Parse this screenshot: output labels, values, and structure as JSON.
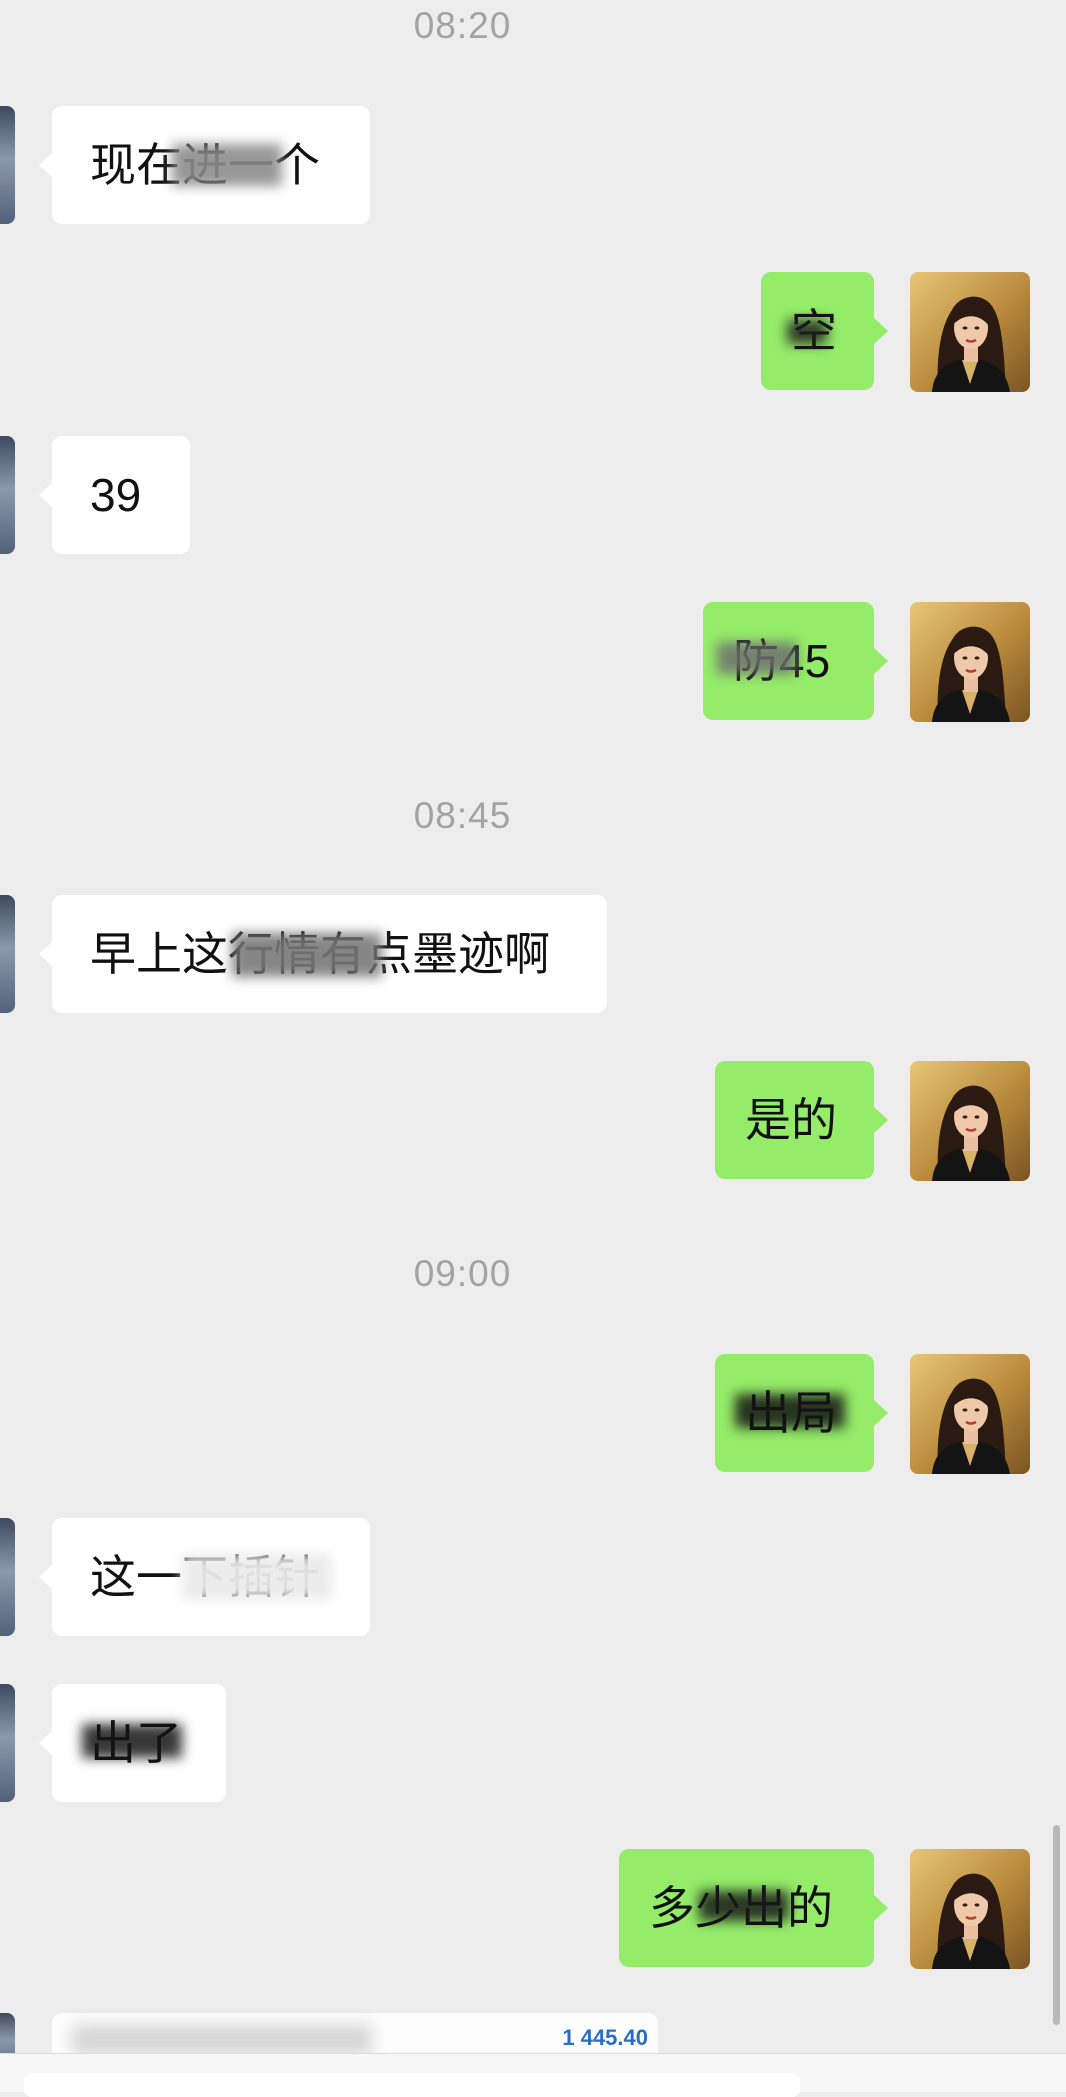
{
  "timestamps": [
    "08:20",
    "08:45",
    "09:00"
  ],
  "messages": [
    {
      "side": "in",
      "text": "现在进一个"
    },
    {
      "side": "out",
      "text": "空"
    },
    {
      "side": "in",
      "text": "39"
    },
    {
      "side": "out",
      "text": "防45"
    },
    {
      "side": "in",
      "text": "早上这行情有点墨迹啊"
    },
    {
      "side": "out",
      "text": "是的"
    },
    {
      "side": "out",
      "text": "出局"
    },
    {
      "side": "in",
      "text": "这一下插针"
    },
    {
      "side": "in",
      "text": "出了"
    },
    {
      "side": "out",
      "text": "多少出的"
    }
  ],
  "preview": {
    "amount": "1 445.40"
  },
  "colors": {
    "background": "#ededed",
    "outgoing_bubble": "#95ec69",
    "incoming_bubble": "#ffffff",
    "timestamp": "#a3a3a3",
    "amount": "#2a6cc6"
  },
  "icons": {
    "incoming_avatar": "contact-avatar-icon",
    "outgoing_avatar": "woman-portrait-avatar-icon"
  }
}
